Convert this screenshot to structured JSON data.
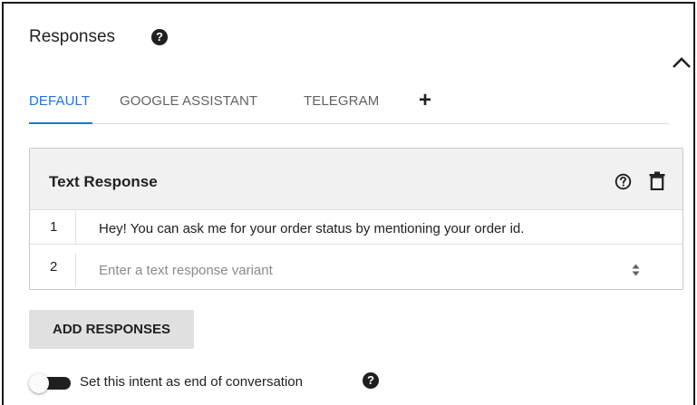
{
  "section": {
    "title": "Responses",
    "help_icon_glyph": "?",
    "collapse_icon": "chevron-up-icon"
  },
  "tabs": [
    {
      "label": "DEFAULT",
      "active": true
    },
    {
      "label": "GOOGLE ASSISTANT",
      "active": false
    },
    {
      "label": "TELEGRAM",
      "active": false
    }
  ],
  "add_tab_glyph": "+",
  "card": {
    "title": "Text Response",
    "rows": [
      {
        "number": "1",
        "text": "Hey! You can ask me for your order status by mentioning your order id."
      },
      {
        "number": "2",
        "placeholder": "Enter a text response variant"
      }
    ]
  },
  "add_responses_label": "ADD RESPONSES",
  "end_conversation": {
    "label": "Set this intent as end of conversation",
    "enabled": false
  },
  "colors": {
    "accent": "#1a73e8",
    "text": "#202124",
    "muted": "#5f6368",
    "card_header_bg": "#f1f1f1",
    "button_bg": "#e0e0e0"
  }
}
